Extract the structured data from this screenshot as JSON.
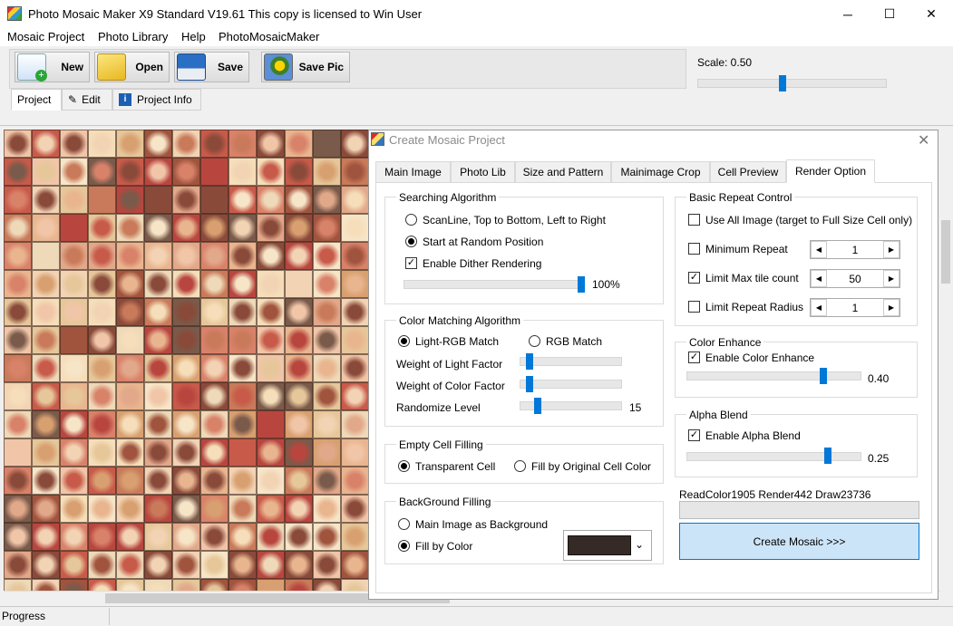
{
  "window": {
    "title": "Photo Mosaic Maker X9 Standard V19.61    This copy is licensed to Win User",
    "controls": {
      "minimize": "─",
      "maximize": "☐",
      "close": "✕"
    }
  },
  "menu": [
    "Mosaic Project",
    "Photo Library",
    "Help",
    "PhotoMosaicMaker"
  ],
  "toolbar": {
    "buttons": [
      {
        "label": "New",
        "icon": "new-document-icon"
      },
      {
        "label": "Open",
        "icon": "open-folder-icon"
      },
      {
        "label": "Save",
        "icon": "floppy-disk-icon"
      },
      {
        "label": "Save Pic",
        "icon": "save-picture-icon"
      }
    ],
    "subtabs": [
      {
        "label": "Project",
        "icon": ""
      },
      {
        "label": "Edit",
        "icon": "pencil-icon"
      },
      {
        "label": "Project Info",
        "icon": "info-icon"
      }
    ],
    "scale_label": "Scale: 0.50",
    "scale_value": 0.5
  },
  "status": {
    "text": "Progress"
  },
  "dialog": {
    "title": "Create Mosaic Project",
    "close": "✕",
    "tabs": [
      "Main Image",
      "Photo Lib",
      "Size and Pattern",
      "Mainimage Crop",
      "Cell Preview",
      "Render Option"
    ],
    "active_tab": "Render Option",
    "searching": {
      "title": "Searching Algorithm",
      "options": [
        "ScanLine, Top to Bottom, Left to Right",
        "Start at Random Position"
      ],
      "selected": 1,
      "dither_label": "Enable Dither Rendering",
      "dither_checked": true,
      "dither_value_label": "100%",
      "dither_value": 1.0
    },
    "color_matching": {
      "title": "Color Matching Algorithm",
      "options": [
        "Light-RGB Match",
        "RGB Match"
      ],
      "selected": 0,
      "light_factor_label": "Weight of Light Factor",
      "light_factor": 0.02,
      "color_factor_label": "Weight of Color Factor",
      "color_factor": 0.02,
      "randomize_label": "Randomize Level",
      "randomize_value_label": "15",
      "randomize_value": 0.15
    },
    "empty_cell": {
      "title": "Empty Cell Filling",
      "options": [
        "Transparent Cell",
        "Fill by Original Cell Color"
      ],
      "selected": 0
    },
    "background": {
      "title": "BackGround Filling",
      "options": [
        "Main Image as Background",
        "Fill by Color"
      ],
      "selected": 1,
      "color": "#362a26"
    },
    "repeat": {
      "title": "Basic Repeat Control",
      "use_all_label": "Use All Image (target to Full Size Cell only)",
      "use_all_checked": false,
      "rows": [
        {
          "label": "Minimum Repeat",
          "checked": false,
          "value": "1"
        },
        {
          "label": "Limit Max tile count",
          "checked": true,
          "value": "50"
        },
        {
          "label": "Limit Repeat Radius",
          "checked": false,
          "value": "1"
        }
      ]
    },
    "color_enhance": {
      "title": "Color Enhance",
      "label": "Enable Color Enhance",
      "checked": true,
      "value_label": "0.40",
      "value": 0.4
    },
    "alpha_blend": {
      "title": "Alpha Blend",
      "label": "Enable Alpha Blend",
      "checked": true,
      "value_label": "0.25",
      "value": 0.25
    },
    "counters": "ReadColor1905   Render442   Draw23736",
    "create_button": "Create Mosaic >>>"
  }
}
